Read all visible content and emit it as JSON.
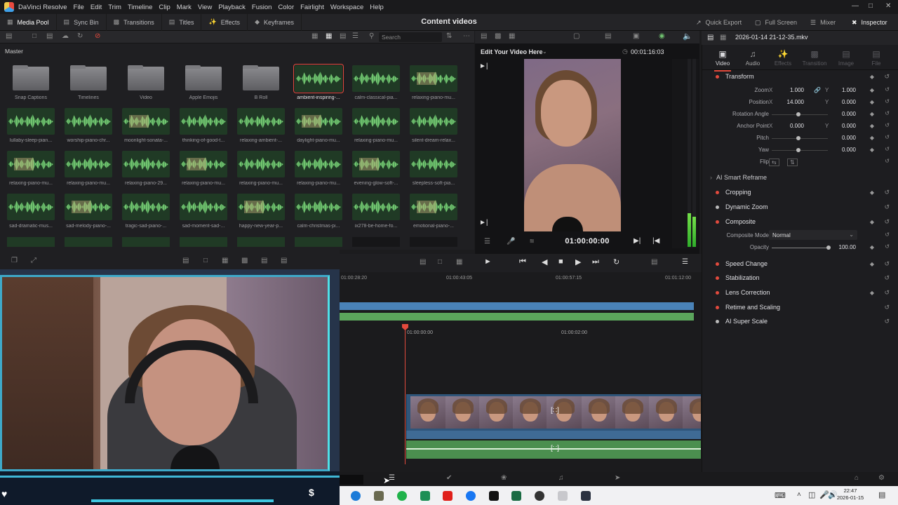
{
  "menubar": {
    "app": "DaVinci Resolve",
    "items": [
      "File",
      "Edit",
      "Trim",
      "Timeline",
      "Clip",
      "Mark",
      "View",
      "Playback",
      "Fusion",
      "Color",
      "Fairlight",
      "Workspace",
      "Help"
    ]
  },
  "toolbar": {
    "media_pool": "Media Pool",
    "sync_bin": "Sync Bin",
    "transitions": "Transitions",
    "titles": "Titles",
    "effects": "Effects",
    "keyframes": "Keyframes",
    "project_title": "Content videos",
    "quick_export": "Quick Export",
    "full_screen": "Full Screen",
    "mixer": "Mixer",
    "inspector": "Inspector"
  },
  "media_pool": {
    "search_placeholder": "Search",
    "bin": "Master",
    "clips": [
      {
        "name": "Snap Captions",
        "kind": "folder"
      },
      {
        "name": "Timelines",
        "kind": "folder"
      },
      {
        "name": "Video",
        "kind": "folder"
      },
      {
        "name": "Apple Emojis",
        "kind": "folder"
      },
      {
        "name": "B Roll",
        "kind": "folder"
      },
      {
        "name": "ambient-inspiring-...",
        "kind": "wave",
        "selected": true
      },
      {
        "name": "calm-classical-pia...",
        "kind": "wave"
      },
      {
        "name": "relaxing-piano-mu...",
        "kind": "wave"
      },
      {
        "name": "lullaby-sleep-pian...",
        "kind": "wave"
      },
      {
        "name": "worship-piano-chr...",
        "kind": "wave"
      },
      {
        "name": "moonlight-sonata-...",
        "kind": "wave"
      },
      {
        "name": "thinking-of-good-t...",
        "kind": "wave"
      },
      {
        "name": "relaxing-ambient-...",
        "kind": "wave"
      },
      {
        "name": "daylight-piano-mu...",
        "kind": "wave"
      },
      {
        "name": "relaxing-piano-mu...",
        "kind": "wave"
      },
      {
        "name": "silent-dream-relax...",
        "kind": "wave"
      },
      {
        "name": "relaxing-piano-mu...",
        "kind": "wave"
      },
      {
        "name": "relaxing-piano-mu...",
        "kind": "wave"
      },
      {
        "name": "relaxing-piano-29...",
        "kind": "wave"
      },
      {
        "name": "relaxing-piano-mu...",
        "kind": "wave"
      },
      {
        "name": "relaxing-piano-mu...",
        "kind": "wave"
      },
      {
        "name": "relaxing-piano-mu...",
        "kind": "wave"
      },
      {
        "name": "evening-glow-soft-...",
        "kind": "wave"
      },
      {
        "name": "sleepless-soft-pia...",
        "kind": "wave"
      },
      {
        "name": "sad-dramatic-mus...",
        "kind": "wave"
      },
      {
        "name": "sad-melody-piano-...",
        "kind": "wave"
      },
      {
        "name": "tragic-sad-piano-...",
        "kind": "wave"
      },
      {
        "name": "sad-moment-sad-...",
        "kind": "wave"
      },
      {
        "name": "happy-new-year-p...",
        "kind": "wave"
      },
      {
        "name": "calm-christmas-pi...",
        "kind": "wave"
      },
      {
        "name": "ix278-be-home-fo...",
        "kind": "wave"
      },
      {
        "name": "emotional-piano-...",
        "kind": "wave"
      }
    ]
  },
  "viewer": {
    "title": "Edit Your Video Here",
    "duration": "00:01:16:03",
    "timecode": "01:00:00:00",
    "meter_levels": [
      0.18,
      0.16
    ]
  },
  "inspector": {
    "filename": "2026-01-14 21-12-35.mkv",
    "tabs": [
      "Video",
      "Audio",
      "Effects",
      "Transition",
      "Image",
      "File"
    ],
    "transform": {
      "title": "Transform",
      "zoom_label": "Zoom",
      "zoom_x": "1.000",
      "zoom_y": "1.000",
      "position_label": "Position",
      "position_x": "14.000",
      "position_y": "0.000",
      "rotation_label": "Rotation Angle",
      "rotation": "0.000",
      "anchor_label": "Anchor Point",
      "anchor_x": "0.000",
      "anchor_y": "0.000",
      "pitch_label": "Pitch",
      "pitch": "0.000",
      "yaw_label": "Yaw",
      "yaw": "0.000",
      "flip_label": "Flip",
      "axis_x": "X",
      "axis_y": "Y"
    },
    "smart_reframe": "AI Smart Reframe",
    "cropping": "Cropping",
    "dynamic_zoom": "Dynamic Zoom",
    "composite": {
      "title": "Composite",
      "mode_label": "Composite Mode",
      "mode": "Normal",
      "opacity_label": "Opacity",
      "opacity": "100.00"
    },
    "sections": [
      "Speed Change",
      "Stabilization",
      "Lens Correction",
      "Retime and Scaling",
      "AI Super Scale"
    ]
  },
  "timeline": {
    "ruler_top": [
      "01:00:28:20",
      "01:00:43:05",
      "01:00:57:15",
      "01:01:12:00"
    ],
    "ruler_bottom": [
      "01:00:00:00",
      "01:00:02:00"
    ]
  },
  "taskbar": {
    "time": "22:47",
    "date": "2026-01-15"
  }
}
